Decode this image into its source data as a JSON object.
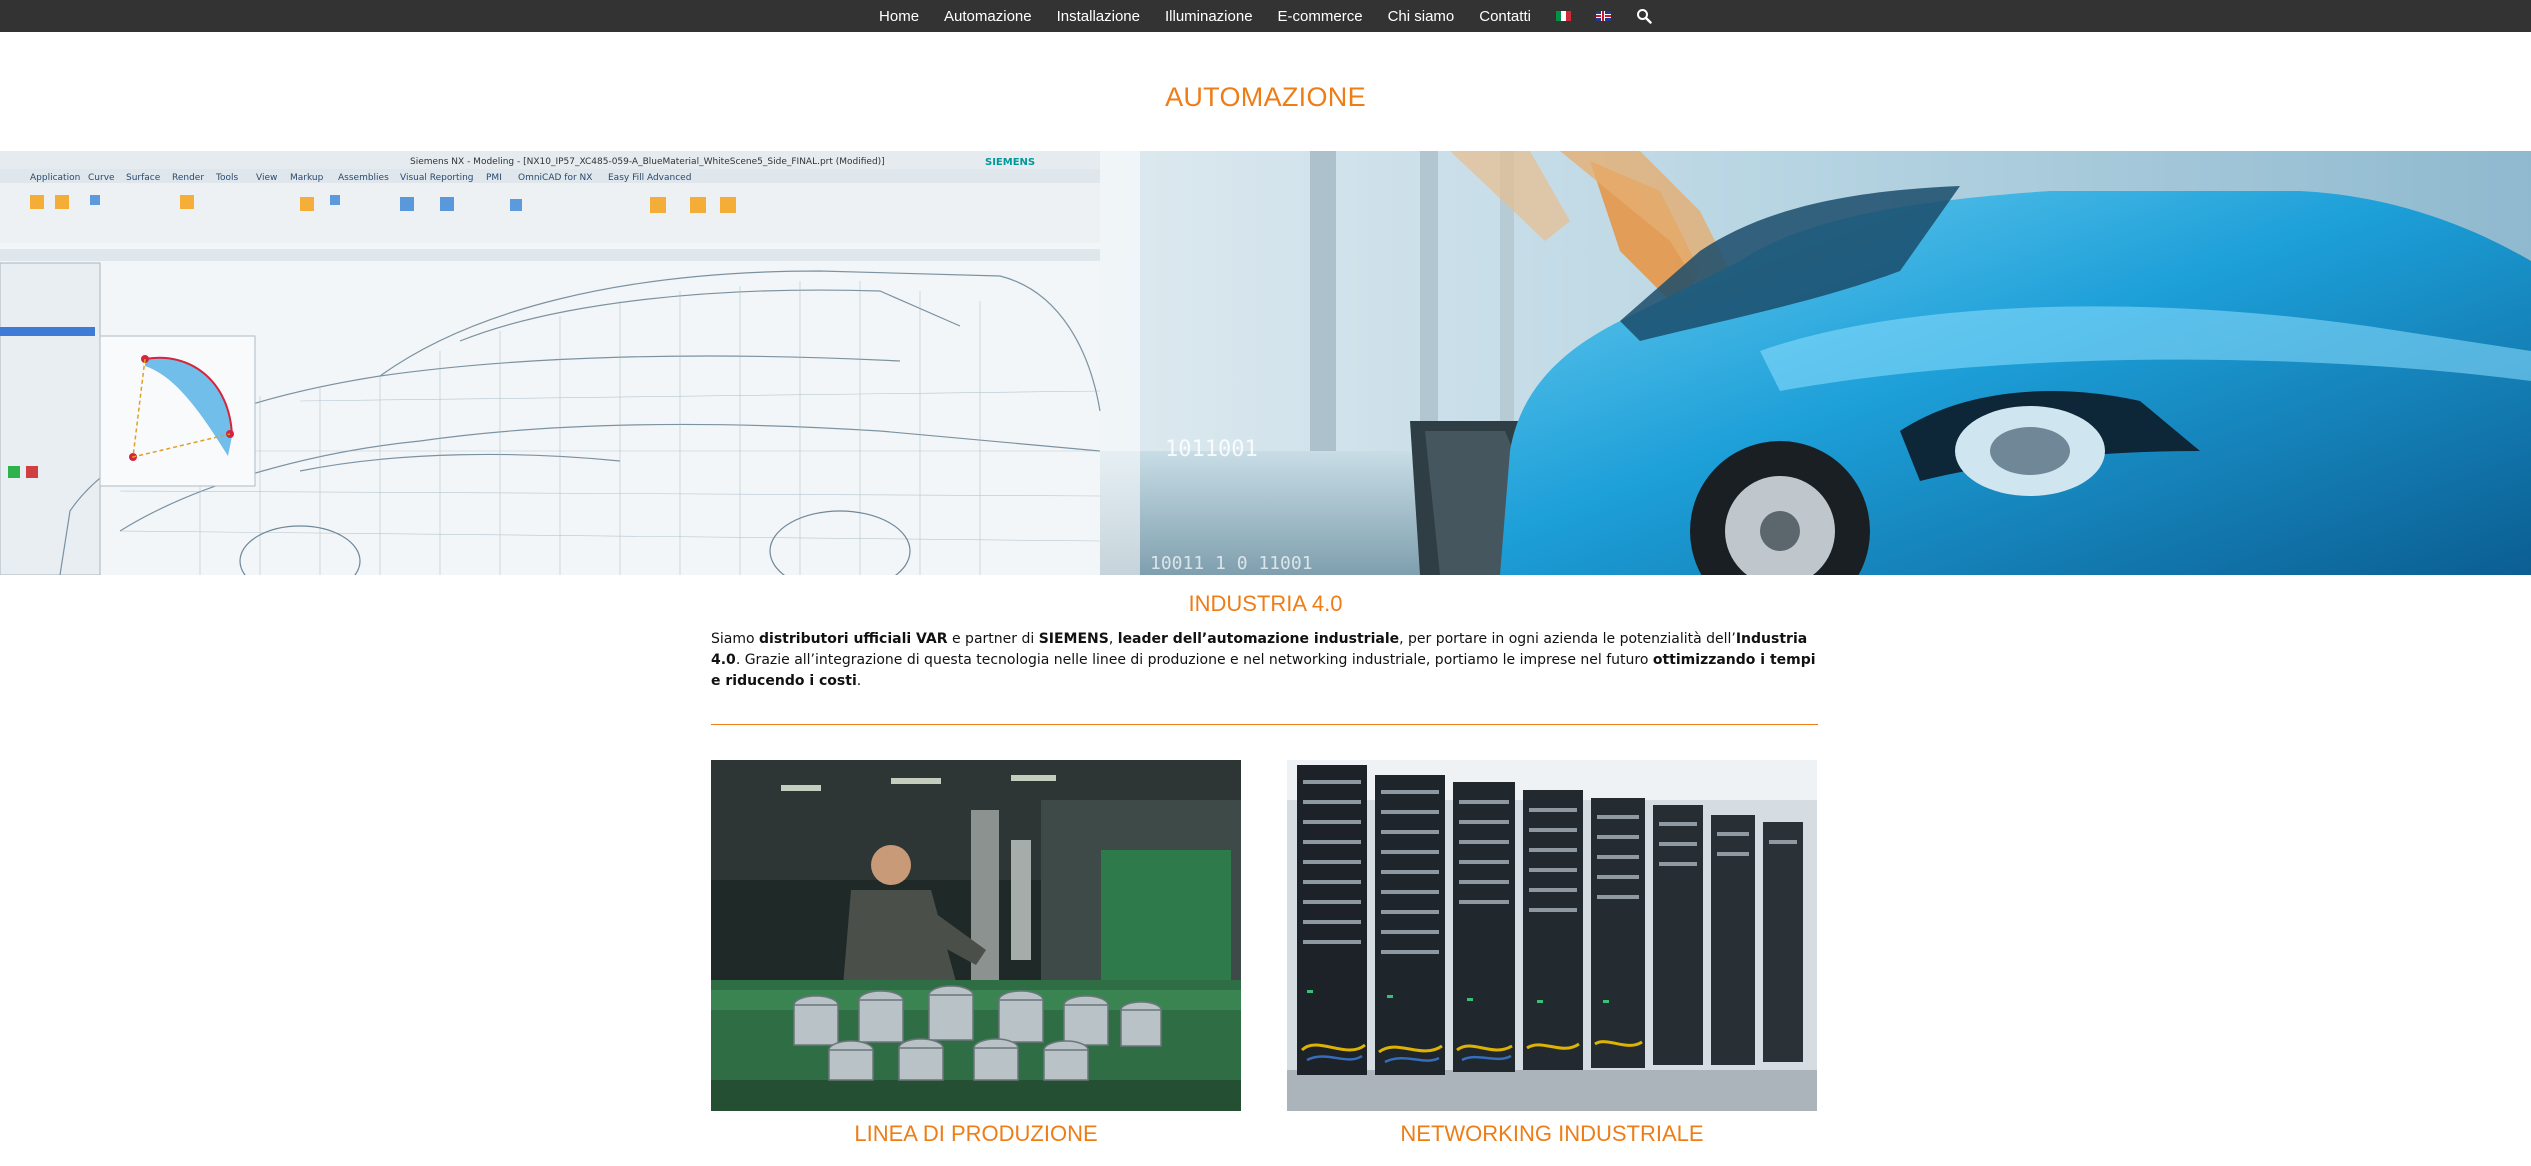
{
  "nav": {
    "items": [
      "Home",
      "Automazione",
      "Installazione",
      "Illuminazione",
      "E-commerce",
      "Chi siamo",
      "Contatti"
    ],
    "lang_flags": [
      "italian-flag-icon",
      "english-flag-icon"
    ],
    "search_icon": "search-icon"
  },
  "page": {
    "title": "AUTOMAZIONE"
  },
  "hero": {
    "software_title": "Siemens NX - Modeling - [NX10_IP57_XC485-059-A_BlueMaterial_WhiteScene5_Side_FINAL.prt (Modified)]",
    "software_brand": "SIEMENS",
    "menu_items": [
      "Application",
      "Curve",
      "Surface",
      "Render",
      "Tools",
      "View",
      "Markup",
      "Assemblies",
      "Visual Reporting",
      "PMI",
      "OmniCAD for NX",
      "Easy Fill Advanced"
    ],
    "binary_text": [
      "1011001",
      "10011 1 0 11001"
    ]
  },
  "section": {
    "title": "INDUSTRIA 4.0",
    "intro": {
      "p1": "Siamo ",
      "b1": "distributori ufficiali VAR",
      "p2": " e partner di ",
      "b2": "SIEMENS",
      "p3": ", ",
      "b3": "leader dell’automazione industriale",
      "p4": ", per portare in ogni azienda le potenzialità dell’",
      "b4": "Industria 4.0",
      "p5": ". Grazie all’integrazione di questa tecnologia nelle linee di produzione e nel networking industriale, portiamo le imprese nel futuro ",
      "b5": "ottimizzando i tempi e riducendo i costi",
      "p6": "."
    }
  },
  "cards": [
    {
      "title": "LINEA DI PRODUZIONE"
    },
    {
      "title": "NETWORKING INDUSTRIALE"
    }
  ],
  "colors": {
    "accent": "#ee7d16",
    "topbar": "#333333"
  }
}
